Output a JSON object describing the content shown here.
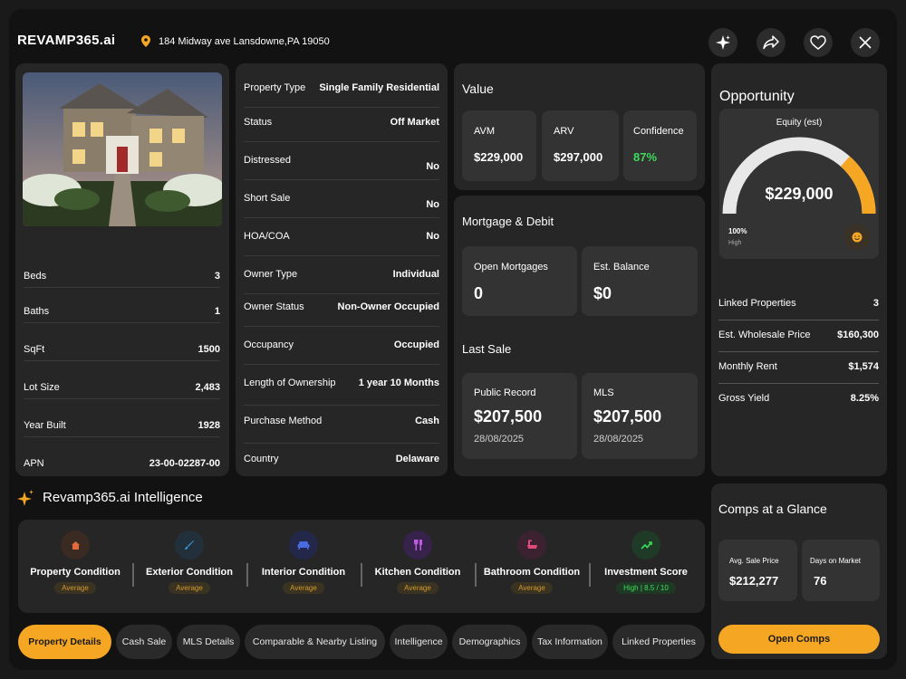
{
  "header": {
    "logo": "REVAMP365.ai",
    "address": "184 Midway ave Lansdowne,PA 19050",
    "icons": [
      "sparkle-icon",
      "share-icon",
      "heart-icon",
      "close-icon"
    ]
  },
  "property": {
    "image_alt": "House photo",
    "facts": [
      {
        "label": "Beds",
        "value": "3"
      },
      {
        "label": "Baths",
        "value": "1"
      },
      {
        "label": "SqFt",
        "value": "1500"
      },
      {
        "label": "Lot Size",
        "value": "2,483"
      },
      {
        "label": "Year Built",
        "value": "1928"
      },
      {
        "label": "APN",
        "value": "23-00-02287-00"
      }
    ]
  },
  "details": [
    {
      "label": "Property Type",
      "value": "Single Family Residential"
    },
    {
      "label": "Status",
      "value": "Off Market"
    },
    {
      "label": "Distressed",
      "value": "No"
    },
    {
      "label": "Short Sale",
      "value": "No"
    },
    {
      "label": "HOA/COA",
      "value": "No"
    },
    {
      "label": "Owner Type",
      "value": "Individual"
    },
    {
      "label": "Owner Status",
      "value": "Non-Owner Occupied"
    },
    {
      "label": "Occupancy",
      "value": "Occupied"
    },
    {
      "label": "Length of Ownership",
      "value": "1 year 10 Months"
    },
    {
      "label": "Purchase Method",
      "value": "Cash"
    },
    {
      "label": "Country",
      "value": "Delaware"
    }
  ],
  "value": {
    "title": "Value",
    "avm_label": "AVM",
    "avm": "$229,000",
    "arv_label": "ARV",
    "arv": "$297,000",
    "conf_label": "Confidence",
    "conf": "87%",
    "conf_color": "#3ddc5c"
  },
  "mortgage": {
    "title": "Mortgage & Debit",
    "open_label": "Open Mortgages",
    "open": "0",
    "bal_label": "Est. Balance",
    "bal": "$0"
  },
  "last_sale": {
    "title": "Last Sale",
    "pr_label": "Public Record",
    "pr_price": "$207,500",
    "pr_date": "28/08/2025",
    "mls_label": "MLS",
    "mls_price": "$207,500",
    "mls_date": "28/08/2025"
  },
  "opportunity": {
    "title": "Opportunity",
    "equity_label": "Equity (est)",
    "equity": "$229,000",
    "gauge_pct": "100%",
    "gauge_level": "High",
    "gauge_fill": 0.27,
    "rows": [
      {
        "label": "Linked Properties",
        "value": "3"
      },
      {
        "label": "Est. Wholesale Price",
        "value": "$160,300"
      },
      {
        "label": "Monthly Rent",
        "value": "$1,574"
      },
      {
        "label": "Gross Yield",
        "value": "8.25%"
      }
    ]
  },
  "comps": {
    "title": "Comps at a Glance",
    "avg_label": "Avg. Sale Price",
    "avg": "$212,277",
    "days_label": "Days on Market",
    "days": "76",
    "button": "Open Comps"
  },
  "intelligence": {
    "title": "Revamp365.ai Intelligence",
    "items": [
      {
        "label": "Property Condition",
        "badge": "Average",
        "icon": "home-icon"
      },
      {
        "label": "Exterior Condition",
        "badge": "Average",
        "icon": "brush-icon"
      },
      {
        "label": "Interior Condition",
        "badge": "Average",
        "icon": "sofa-icon"
      },
      {
        "label": "Kitchen Condition",
        "badge": "Average",
        "icon": "utensils-icon"
      },
      {
        "label": "Bathroom Condition",
        "badge": "Average",
        "icon": "bathtub-icon"
      },
      {
        "label": "Investment Score",
        "badge": "High | 8.5 / 10",
        "icon": "trend-up-icon"
      }
    ]
  },
  "tabs": [
    "Property Details",
    "Cash Sale",
    "MLS Details",
    "Comparable & Nearby Listing",
    "Intelligence",
    "Demographics",
    "Tax Information",
    "Linked Properties"
  ],
  "colors": {
    "accent": "#f5a623",
    "panel": "#262626",
    "card": "#333333",
    "positive": "#3ddc5c"
  }
}
